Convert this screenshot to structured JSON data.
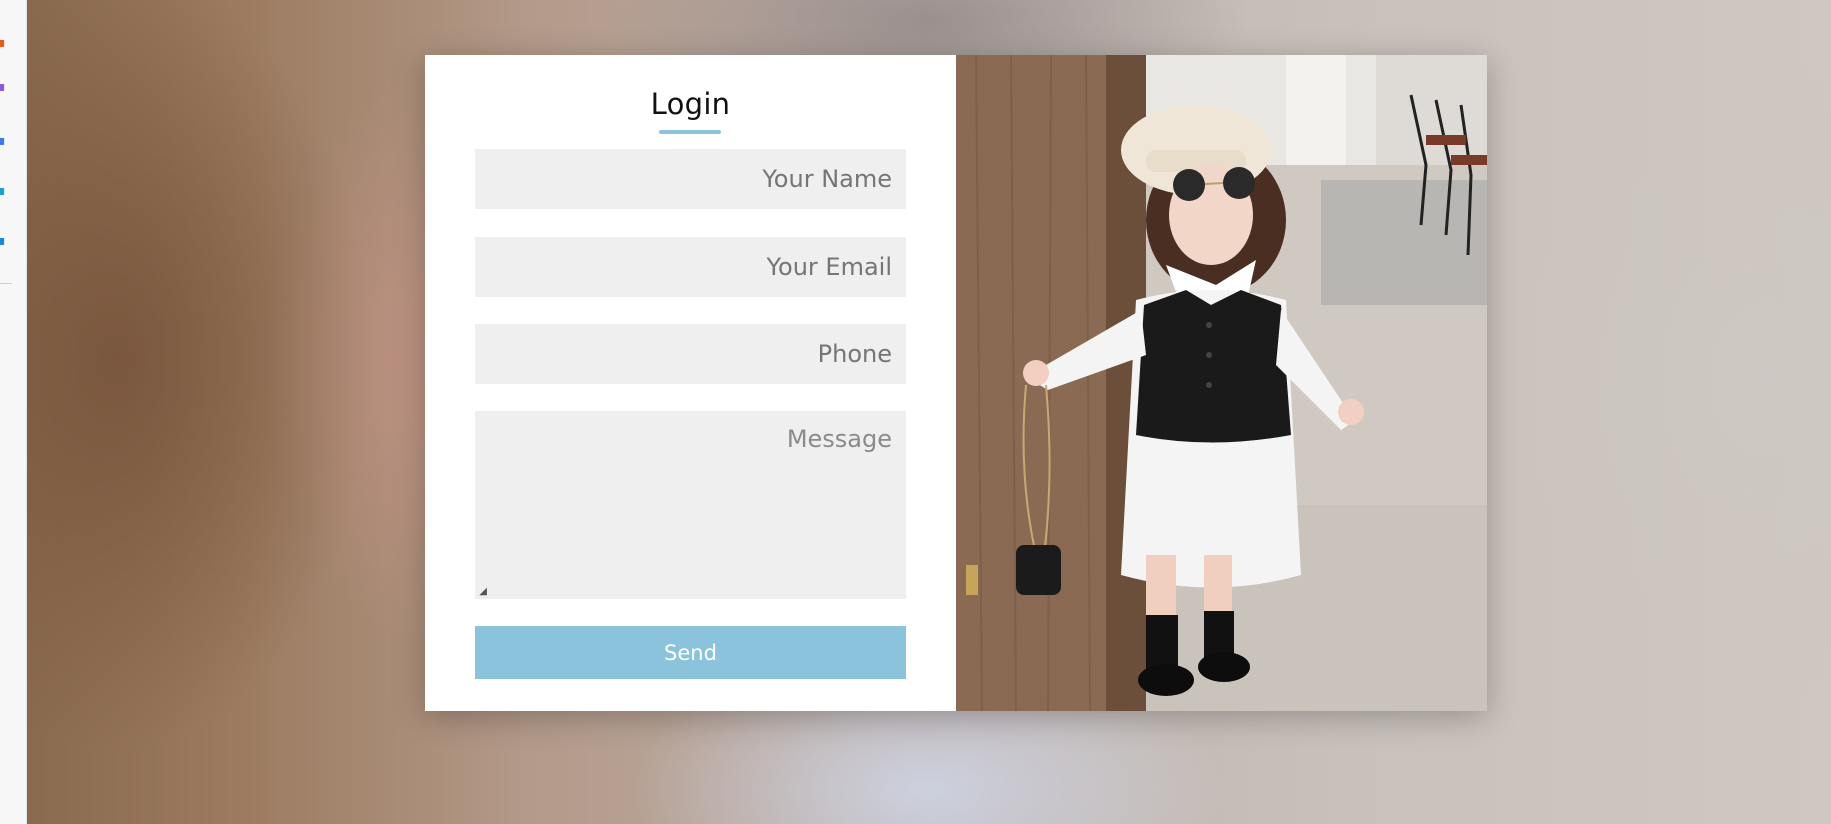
{
  "form": {
    "title": "Login",
    "name_placeholder": "Your Name",
    "email_placeholder": "Your Email",
    "phone_placeholder": "Phone",
    "message_placeholder": "Message",
    "send_label": "Send"
  },
  "colors": {
    "accent": "#8bc3dc",
    "field_bg": "#efefef",
    "panel_bg": "#ffffff"
  },
  "photo": {
    "icon": "photo-image"
  }
}
